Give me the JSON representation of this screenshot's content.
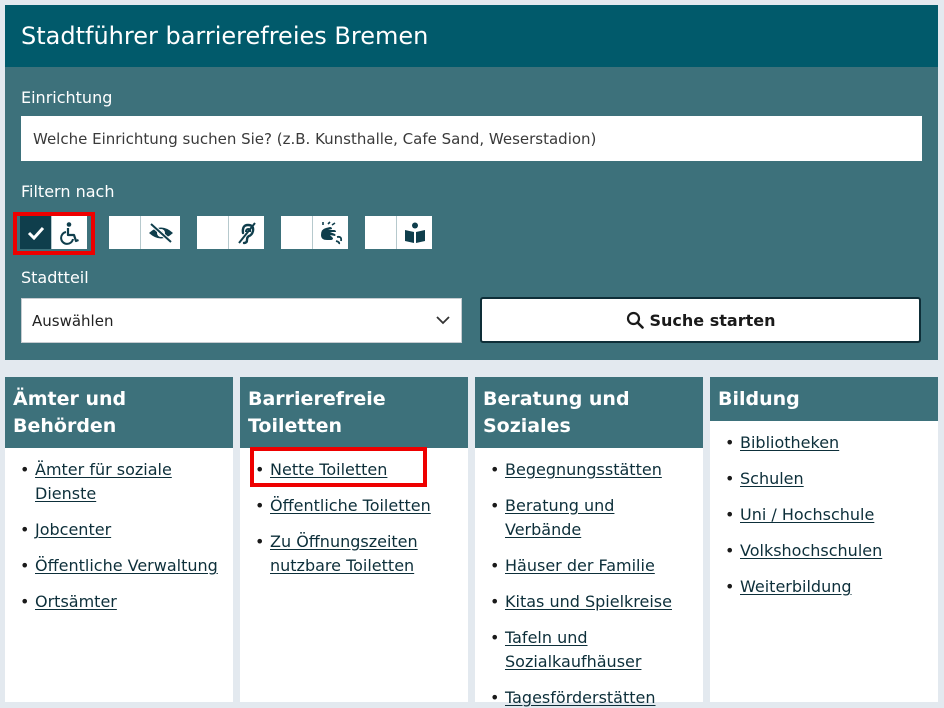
{
  "header": {
    "title": "Stadtführer barrierefreies Bremen"
  },
  "search": {
    "label": "Einrichtung",
    "placeholder": "Welche Einrichtung suchen Sie? (z.B. Kunsthalle, Cafe Sand, Weserstadion)"
  },
  "filters": {
    "label": "Filtern nach",
    "items": [
      {
        "icon": "wheelchair-icon",
        "checked": true
      },
      {
        "icon": "visually-impaired-icon",
        "checked": false
      },
      {
        "icon": "hearing-impaired-icon",
        "checked": false
      },
      {
        "icon": "sign-language-icon",
        "checked": false
      },
      {
        "icon": "easy-reading-icon",
        "checked": false
      }
    ]
  },
  "district": {
    "label": "Stadtteil",
    "selected": "Auswählen"
  },
  "submit": {
    "label": "Suche starten"
  },
  "colors": {
    "header": "#015a6b",
    "panel": "#3d717b",
    "highlight": "#e00000"
  },
  "categories": [
    {
      "title": "Ämter und Behörden",
      "links": [
        "Ämter für soziale Dienste",
        "Jobcenter",
        "Öffentliche Verwaltung",
        "Ortsämter"
      ]
    },
    {
      "title": "Barrierefreie Toiletten",
      "links": [
        "Nette Toiletten",
        "Öffentliche Toiletten",
        "Zu Öffnungszeiten nutzbare Toiletten"
      ]
    },
    {
      "title": "Beratung und Soziales",
      "links": [
        "Begegnungsstätten",
        "Beratung und Verbände",
        "Häuser der Familie",
        "Kitas und Spielkreise",
        "Tafeln und Sozialkaufhäuser",
        "Tagesförderstätten"
      ]
    },
    {
      "title": "Bildung",
      "links": [
        "Bibliotheken",
        "Schulen",
        "Uni / Hochschule",
        "Volkshochschulen",
        "Weiterbildung"
      ]
    }
  ]
}
